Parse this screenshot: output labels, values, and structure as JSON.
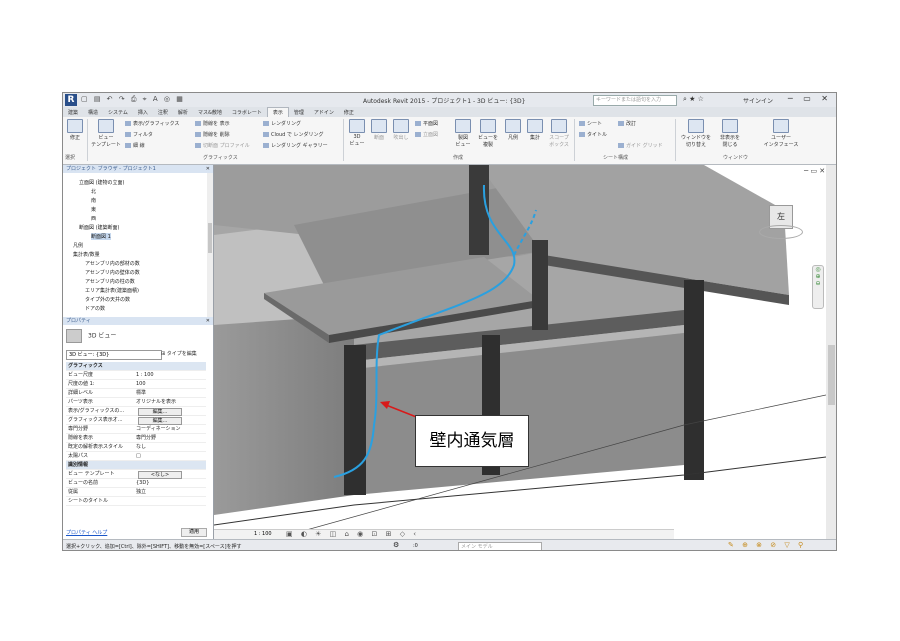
{
  "app": {
    "title": "Autodesk Revit 2015 -    プロジェクト1 - 3D ビュー: {3D}",
    "search_placeholder": "キーワードまたは語句を入力",
    "signin": "サインイン"
  },
  "tabs": [
    "建築",
    "構造",
    "システム",
    "挿入",
    "注釈",
    "解析",
    "マス&敷地",
    "コラボレート",
    "表示",
    "管理",
    "アドイン",
    "修正"
  ],
  "active_tab": "表示",
  "ribbon": {
    "modify": "修正",
    "select_label": "選択",
    "view_template": "ビュー\nテンプレート",
    "visibility_graphics": "表示/グラフィックス",
    "filters": "フィルタ",
    "thin_lines": "細 線",
    "show_hidden": "隠線を 表示",
    "remove_hidden": "隠線を 削除",
    "cut_profile": "切断面 プロファイル",
    "rendering": "レンダリング",
    "cloud_rendering": "Cloud で レンダリング",
    "render_gallery": "レンダリング ギャラリー",
    "graphics_label": "グラフィックス",
    "view_3d": "3D\nビュー",
    "section": "断面",
    "callout": "吹出し",
    "plan_views": "平面図",
    "elevation": "立面図",
    "drafting_view": "製図\nビュー",
    "duplicate_view": "ビューを\n複製",
    "legends": "凡例",
    "schedules": "集計",
    "scope_box": "スコープ\nボックス",
    "create_label": "作成",
    "sheet": "シート",
    "title_block": "タイトル",
    "revisions": "改訂",
    "guide_grid": "ガイド グリッド",
    "sheet_comp_label": "シート構成",
    "switch_windows": "ウィンドウを\n切り替え",
    "close_hidden": "非表示を\n閉じる",
    "user_interface": "ユーザー\nインタフェース",
    "window_label": "ウィンドウ"
  },
  "browser": {
    "header": "プロジェクト ブラウザ - プロジェクト1",
    "items": [
      {
        "label": "立面図 (建物の立面)",
        "indent": 2
      },
      {
        "label": "北",
        "indent": 4
      },
      {
        "label": "南",
        "indent": 4
      },
      {
        "label": "東",
        "indent": 4
      },
      {
        "label": "西",
        "indent": 4
      },
      {
        "label": "断面図 (建築断面)",
        "indent": 2
      },
      {
        "label": "断面図 1",
        "indent": 4,
        "selected": true
      },
      {
        "label": "凡例",
        "indent": 1
      },
      {
        "label": "集計表/数量",
        "indent": 1
      },
      {
        "label": "アセンブリ内の部材の数",
        "indent": 3
      },
      {
        "label": "アセンブリ内の壁体の数",
        "indent": 3
      },
      {
        "label": "アセンブリ内の柱の数",
        "indent": 3
      },
      {
        "label": "エリア集計表(建築面積)",
        "indent": 3
      },
      {
        "label": "タイプ外の天井の数",
        "indent": 3
      },
      {
        "label": "ドアの数",
        "indent": 3
      }
    ]
  },
  "properties": {
    "header": "プロパティ",
    "type_name": "3D ビュー",
    "selector": "3D ビュー: {3D}",
    "edit_type": "タイプを編集",
    "rows": [
      {
        "k": "グラフィックス",
        "cat": true
      },
      {
        "k": "ビュー尺度",
        "v": "1 : 100"
      },
      {
        "k": "尺度の値 1:",
        "v": "100"
      },
      {
        "k": "詳細レベル",
        "v": "標準"
      },
      {
        "k": "パーツ表示",
        "v": "オリジナルを表示"
      },
      {
        "k": "表示/グラフィックスの...",
        "btn": "編集..."
      },
      {
        "k": "グラフィックス表示オ...",
        "btn": "編集..."
      },
      {
        "k": "専門分野",
        "v": "コーディネーション"
      },
      {
        "k": "隠線を表示",
        "v": "専門分野"
      },
      {
        "k": "既定の解析表示スタイル",
        "v": "なし"
      },
      {
        "k": "太陽パス",
        "v": "□"
      },
      {
        "k": "識別情報",
        "cat": true
      },
      {
        "k": "ビュー テンプレート",
        "btn": "<なし>"
      },
      {
        "k": "ビューの名前",
        "v": "{3D}"
      },
      {
        "k": "従属",
        "v": "独立"
      },
      {
        "k": "シートのタイトル",
        "v": ""
      }
    ],
    "help": "プロパティ ヘルプ",
    "apply": "適用"
  },
  "viewbar": {
    "scale": "1 : 100"
  },
  "status": {
    "message": "選択+クリック、追加=[Ctrl]、除外=[SHIFT]、移動を無効=[スペース]を押す",
    "main_model": "メイン モデル",
    "counter": ":0"
  },
  "viewcube": {
    "face": "左"
  },
  "annotation": {
    "text": "壁内通気層"
  },
  "colors": {
    "airflow": "#2aa0e0",
    "arrow": "#d81a1a",
    "model_dark": "#3a3a3a",
    "model_mid": "#8a8a8a",
    "model_light": "#b8b8b8"
  }
}
